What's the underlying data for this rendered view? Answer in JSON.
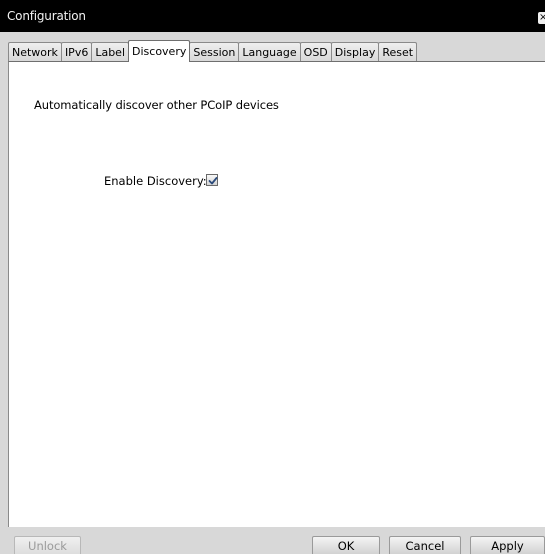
{
  "window": {
    "title": "Configuration",
    "close_glyph": "×",
    "close_icon": "close-icon"
  },
  "tabs": [
    {
      "label": "Network",
      "active": false
    },
    {
      "label": "IPv6",
      "active": false
    },
    {
      "label": "Label",
      "active": false
    },
    {
      "label": "Discovery",
      "active": true
    },
    {
      "label": "Session",
      "active": false
    },
    {
      "label": "Language",
      "active": false
    },
    {
      "label": "OSD",
      "active": false
    },
    {
      "label": "Display",
      "active": false
    },
    {
      "label": "Reset",
      "active": false
    }
  ],
  "discovery": {
    "description": "Automatically discover other PCoIP devices",
    "enable_label": "Enable Discovery:",
    "enable_checked": true
  },
  "footer": {
    "unlock_label": "Unlock",
    "ok_label": "OK",
    "cancel_label": "Cancel",
    "apply_label": "Apply"
  },
  "colors": {
    "titlebar": "#000000",
    "panel": "#ffffff",
    "chrome": "#d8d8d8",
    "check_mark": "#2b4a7a"
  }
}
